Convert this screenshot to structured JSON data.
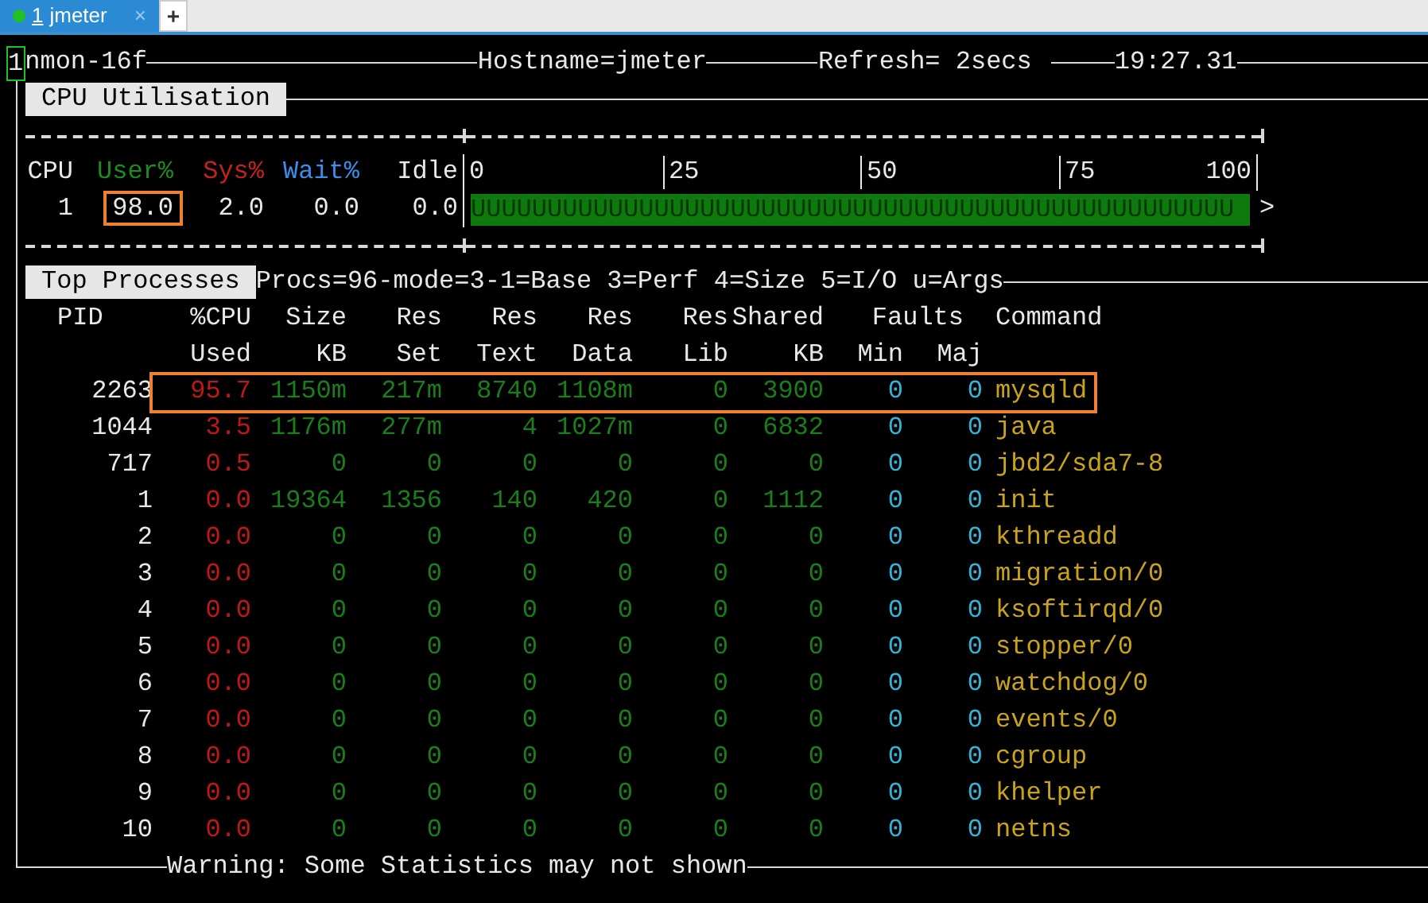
{
  "tabs": [
    {
      "number": "1",
      "label": "jmeter",
      "close": "×",
      "selected": true,
      "color": "#22c022"
    }
  ],
  "new_tab": "+",
  "title_line": {
    "cursor": "1",
    "program": "nmon-16f",
    "hostname": "Hostname=jmeter",
    "refresh": "Refresh= 2secs",
    "time": "19:27.31"
  },
  "cpu_section": {
    "title": "CPU Utilisation",
    "headers": [
      "CPU",
      "User%",
      "Sys%",
      "Wait%",
      "Idle"
    ],
    "scale": [
      "0",
      "25",
      "50",
      "75",
      "100"
    ],
    "rows": [
      {
        "cpu": "1",
        "user": "98.0",
        "sys": "2.0",
        "wait": "0.0",
        "idle": "0.0",
        "user_highlighted": true,
        "level": 1,
        "bar_text": "UUUUUUUUUUUUUUUUUUUUUUUUUUUUUUUUUUUUUUUUUUUUUUUUUU",
        "bar_end": ">"
      }
    ]
  },
  "process_section": {
    "title": "Top Processes",
    "mode_line": "Procs=96-mode=3-1=Base 3=Perf 4=Size 5=I/O u=Args",
    "header_top": [
      "PID",
      "%CPU",
      "Size",
      "Res",
      "Res",
      "Res",
      "Res",
      "Shared",
      "Faults",
      "Command"
    ],
    "header_bottom": [
      "Used",
      "KB",
      "Set",
      "Text",
      "Data",
      "Lib",
      "KB",
      "Min",
      "Maj"
    ],
    "rows": [
      {
        "pid": "2263",
        "cpu": "95.7",
        "size": "1150m",
        "set": "217m",
        "text": "8740",
        "data": "1108m",
        "lib": "0",
        "shared": "3900",
        "min": "0",
        "maj": "0",
        "command": "mysqld",
        "highlighted": true
      },
      {
        "pid": "1044",
        "cpu": "3.5",
        "size": "1176m",
        "set": "277m",
        "text": "4",
        "data": "1027m",
        "lib": "0",
        "shared": "6832",
        "min": "0",
        "maj": "0",
        "command": "java",
        "highlighted": false
      },
      {
        "pid": "717",
        "cpu": "0.5",
        "size": "0",
        "set": "0",
        "text": "0",
        "data": "0",
        "lib": "0",
        "shared": "0",
        "min": "0",
        "maj": "0",
        "command": "jbd2/sda7-8",
        "highlighted": false
      },
      {
        "pid": "1",
        "cpu": "0.0",
        "size": "19364",
        "set": "1356",
        "text": "140",
        "data": "420",
        "lib": "0",
        "shared": "1112",
        "min": "0",
        "maj": "0",
        "command": "init",
        "highlighted": false
      },
      {
        "pid": "2",
        "cpu": "0.0",
        "size": "0",
        "set": "0",
        "text": "0",
        "data": "0",
        "lib": "0",
        "shared": "0",
        "min": "0",
        "maj": "0",
        "command": "kthreadd",
        "highlighted": false
      },
      {
        "pid": "3",
        "cpu": "0.0",
        "size": "0",
        "set": "0",
        "text": "0",
        "data": "0",
        "lib": "0",
        "shared": "0",
        "min": "0",
        "maj": "0",
        "command": "migration/0",
        "highlighted": false
      },
      {
        "pid": "4",
        "cpu": "0.0",
        "size": "0",
        "set": "0",
        "text": "0",
        "data": "0",
        "lib": "0",
        "shared": "0",
        "min": "0",
        "maj": "0",
        "command": "ksoftirqd/0",
        "highlighted": false
      },
      {
        "pid": "5",
        "cpu": "0.0",
        "size": "0",
        "set": "0",
        "text": "0",
        "data": "0",
        "lib": "0",
        "shared": "0",
        "min": "0",
        "maj": "0",
        "command": "stopper/0",
        "highlighted": false
      },
      {
        "pid": "6",
        "cpu": "0.0",
        "size": "0",
        "set": "0",
        "text": "0",
        "data": "0",
        "lib": "0",
        "shared": "0",
        "min": "0",
        "maj": "0",
        "command": "watchdog/0",
        "highlighted": false
      },
      {
        "pid": "7",
        "cpu": "0.0",
        "size": "0",
        "set": "0",
        "text": "0",
        "data": "0",
        "lib": "0",
        "shared": "0",
        "min": "0",
        "maj": "0",
        "command": "events/0",
        "highlighted": false
      },
      {
        "pid": "8",
        "cpu": "0.0",
        "size": "0",
        "set": "0",
        "text": "0",
        "data": "0",
        "lib": "0",
        "shared": "0",
        "min": "0",
        "maj": "0",
        "command": "cgroup",
        "highlighted": false
      },
      {
        "pid": "9",
        "cpu": "0.0",
        "size": "0",
        "set": "0",
        "text": "0",
        "data": "0",
        "lib": "0",
        "shared": "0",
        "min": "0",
        "maj": "0",
        "command": "khelper",
        "highlighted": false
      },
      {
        "pid": "10",
        "cpu": "0.0",
        "size": "0",
        "set": "0",
        "text": "0",
        "data": "0",
        "lib": "0",
        "shared": "0",
        "min": "0",
        "maj": "0",
        "command": "netns",
        "highlighted": false
      }
    ]
  },
  "warning": "Warning: Some Statistics may not shown"
}
